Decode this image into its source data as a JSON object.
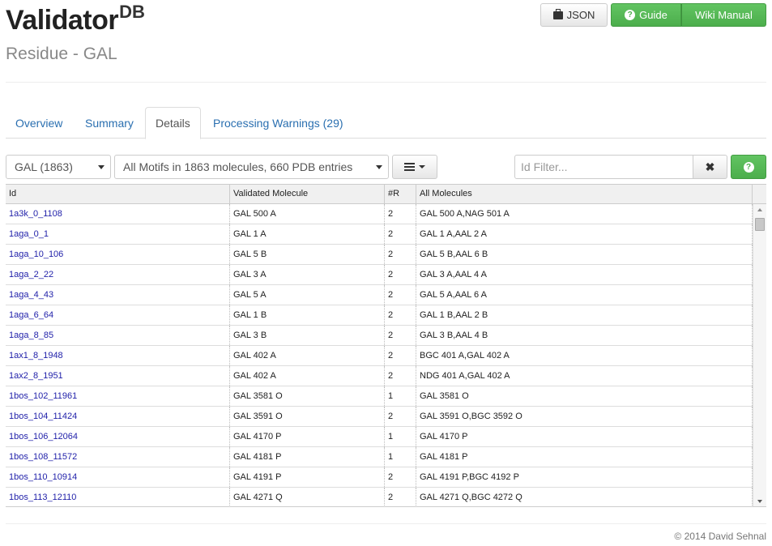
{
  "brand": {
    "title": "Validator",
    "superscript": "DB",
    "subtitle": "Residue - GAL"
  },
  "toolbar": {
    "json_label": "JSON",
    "guide_label": "Guide",
    "wiki_label": "Wiki Manual"
  },
  "tabs": [
    {
      "label": "Overview",
      "active": false
    },
    {
      "label": "Summary",
      "active": false
    },
    {
      "label": "Details",
      "active": true
    },
    {
      "label": "Processing Warnings (29)",
      "active": false
    }
  ],
  "filters": {
    "residue_select": "GAL (1863)",
    "motif_select": "All Motifs in 1863 molecules, 660 PDB entries",
    "id_filter_placeholder": "Id Filter...",
    "clear_symbol": "✖",
    "help_symbol": "?"
  },
  "table": {
    "columns": [
      "Id",
      "Validated Molecule",
      "#R",
      "All Molecules"
    ],
    "rows": [
      [
        "1a3k_0_1108",
        "GAL 500 A",
        "2",
        "GAL 500 A,NAG 501 A"
      ],
      [
        "1aga_0_1",
        "GAL 1 A",
        "2",
        "GAL 1 A,AAL 2 A"
      ],
      [
        "1aga_10_106",
        "GAL 5 B",
        "2",
        "GAL 5 B,AAL 6 B"
      ],
      [
        "1aga_2_22",
        "GAL 3 A",
        "2",
        "GAL 3 A,AAL 4 A"
      ],
      [
        "1aga_4_43",
        "GAL 5 A",
        "2",
        "GAL 5 A,AAL 6 A"
      ],
      [
        "1aga_6_64",
        "GAL 1 B",
        "2",
        "GAL 1 B,AAL 2 B"
      ],
      [
        "1aga_8_85",
        "GAL 3 B",
        "2",
        "GAL 3 B,AAL 4 B"
      ],
      [
        "1ax1_8_1948",
        "GAL 402 A",
        "2",
        "BGC 401 A,GAL 402 A"
      ],
      [
        "1ax2_8_1951",
        "GAL 402 A",
        "2",
        "NDG 401 A,GAL 402 A"
      ],
      [
        "1bos_102_11961",
        "GAL 3581 O",
        "1",
        "GAL 3581 O"
      ],
      [
        "1bos_104_11424",
        "GAL 3591 O",
        "2",
        "GAL 3591 O,BGC 3592 O"
      ],
      [
        "1bos_106_12064",
        "GAL 4170 P",
        "1",
        "GAL 4170 P"
      ],
      [
        "1bos_108_11572",
        "GAL 4181 P",
        "1",
        "GAL 4181 P"
      ],
      [
        "1bos_110_10914",
        "GAL 4191 P",
        "2",
        "GAL 4191 P,BGC 4192 P"
      ],
      [
        "1bos_113_12110",
        "GAL 4271 Q",
        "2",
        "GAL 4271 Q,BGC 4272 Q"
      ]
    ]
  },
  "footer": {
    "copyright": "© 2014 David Sehnal"
  }
}
